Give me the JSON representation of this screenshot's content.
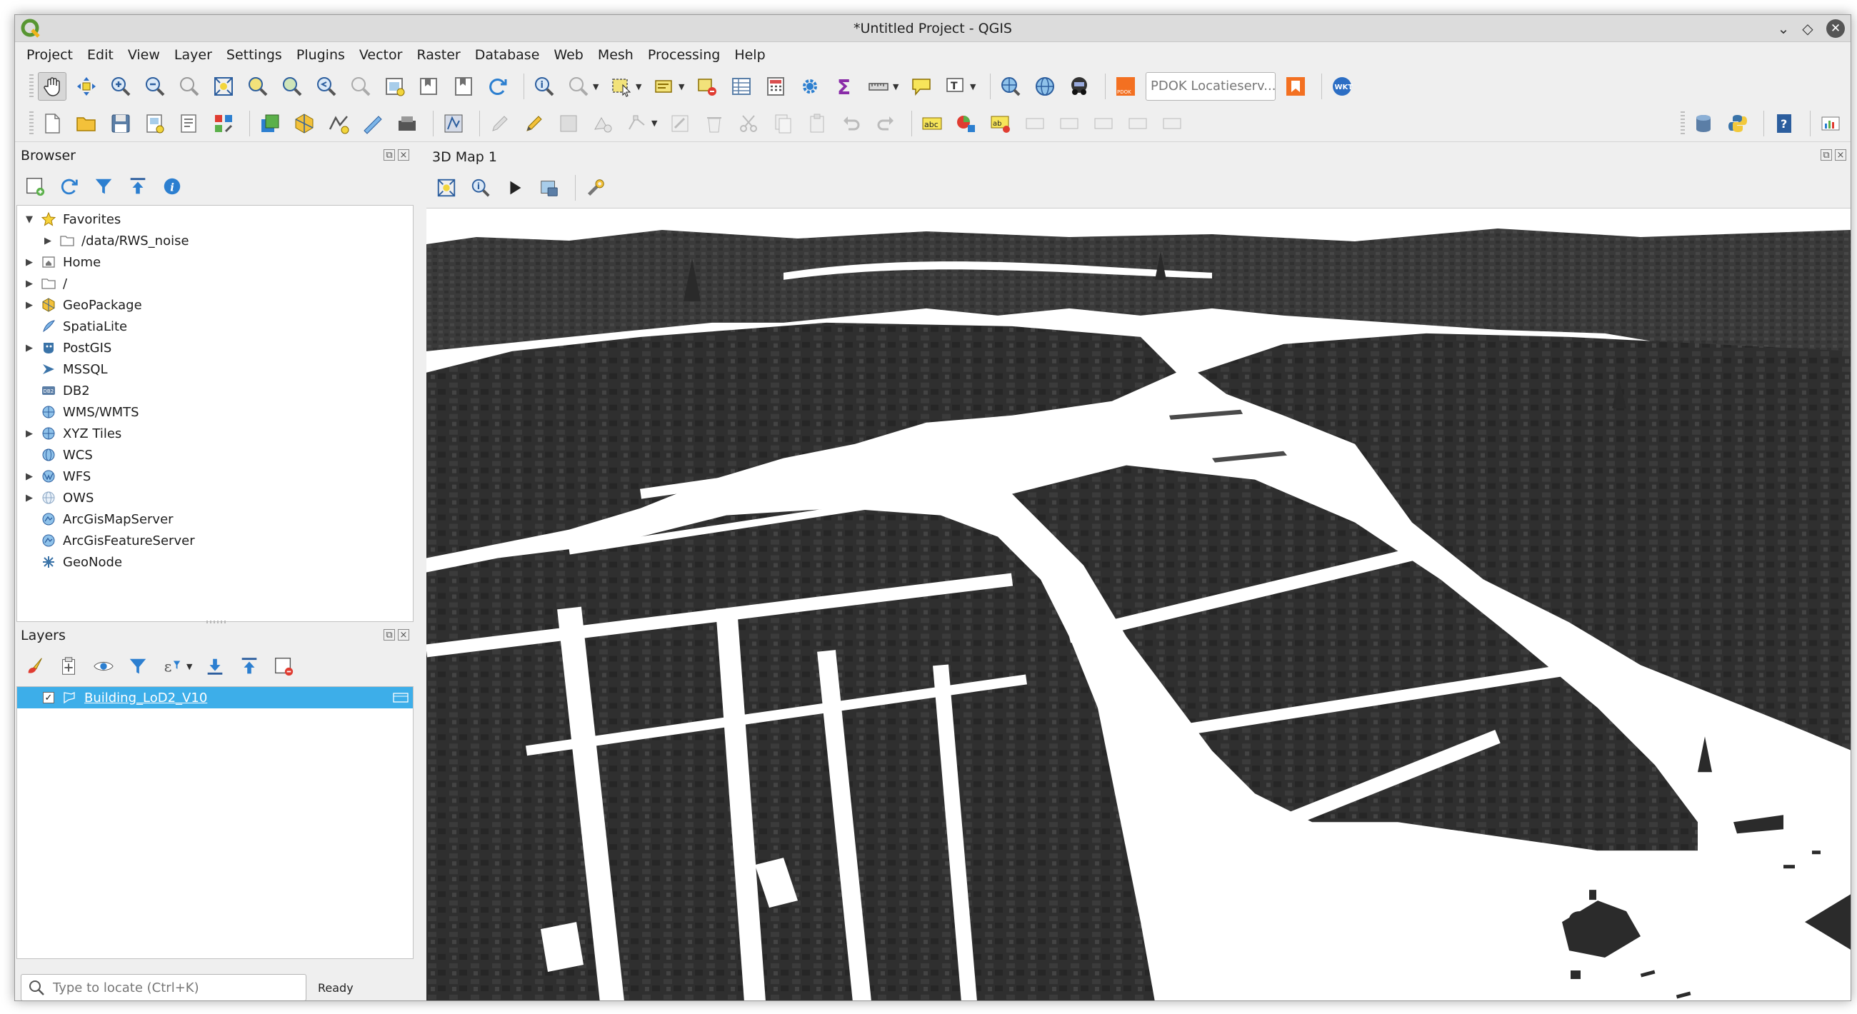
{
  "window": {
    "title": "*Untitled Project - QGIS",
    "controls": [
      "minimize-icon",
      "maximize-icon",
      "close-icon"
    ]
  },
  "menubar": {
    "items": [
      "Project",
      "Edit",
      "View",
      "Layer",
      "Settings",
      "Plugins",
      "Vector",
      "Raster",
      "Database",
      "Web",
      "Mesh",
      "Processing",
      "Help"
    ]
  },
  "toolbar": {
    "locator_plugin_placeholder": "PDOK Locatieserv..."
  },
  "browser": {
    "title": "Browser",
    "items": [
      {
        "label": "Favorites",
        "icon": "star-icon",
        "expanded": true
      },
      {
        "label": "/data/RWS_noise",
        "icon": "folder-icon"
      },
      {
        "label": "Home",
        "icon": "home-folder-icon"
      },
      {
        "label": "/",
        "icon": "folder-icon"
      },
      {
        "label": "GeoPackage",
        "icon": "geopackage-icon"
      },
      {
        "label": "SpatiaLite",
        "icon": "spatialite-icon"
      },
      {
        "label": "PostGIS",
        "icon": "postgis-icon"
      },
      {
        "label": "MSSQL",
        "icon": "mssql-icon"
      },
      {
        "label": "DB2",
        "icon": "db2-icon"
      },
      {
        "label": "WMS/WMTS",
        "icon": "wms-icon"
      },
      {
        "label": "XYZ Tiles",
        "icon": "xyz-tiles-icon"
      },
      {
        "label": "WCS",
        "icon": "wcs-icon"
      },
      {
        "label": "WFS",
        "icon": "wfs-icon"
      },
      {
        "label": "OWS",
        "icon": "ows-icon"
      },
      {
        "label": "ArcGisMapServer",
        "icon": "arcgis-map-server-icon"
      },
      {
        "label": "ArcGisFeatureServer",
        "icon": "arcgis-feature-server-icon"
      },
      {
        "label": "GeoNode",
        "icon": "geonode-icon"
      }
    ]
  },
  "layers": {
    "title": "Layers",
    "items": [
      {
        "label": "Building_LoD2_V10",
        "checked": true,
        "selected": true
      }
    ]
  },
  "statusbar": {
    "locate_placeholder": "Type to locate (Ctrl+K)",
    "status": "Ready"
  },
  "map3d": {
    "title": "3D Map 1"
  },
  "colors": {
    "selection": "#3daee9",
    "building": "#2e2e2e",
    "ground": "#ffffff"
  }
}
